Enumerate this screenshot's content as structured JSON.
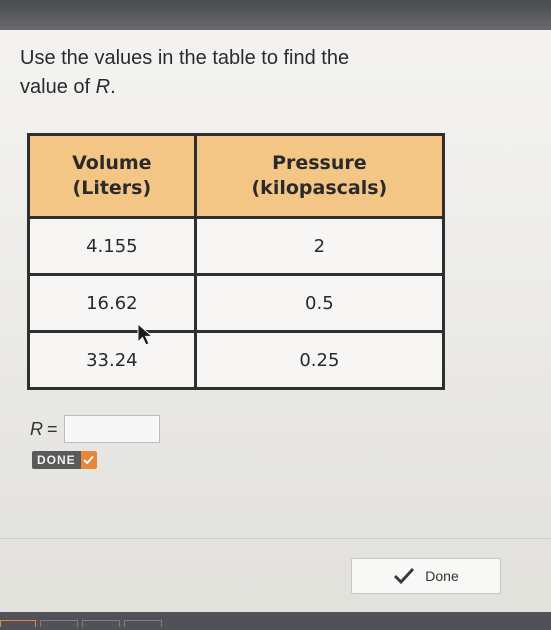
{
  "question": {
    "line1": "Use the values in the table to find the",
    "line2_prefix": "value of ",
    "variable": "R",
    "line2_suffix": "."
  },
  "table": {
    "headers": [
      {
        "line1": "Volume",
        "line2": "(Liters)"
      },
      {
        "line1": "Pressure",
        "line2": "(kilopascals)"
      }
    ],
    "rows": [
      [
        "4.155",
        "2"
      ],
      [
        "16.62",
        "0.5"
      ],
      [
        "33.24",
        "0.25"
      ]
    ]
  },
  "answer": {
    "label": "R",
    "equals": "=",
    "value": ""
  },
  "done_small": {
    "label": "DONE"
  },
  "done_button": {
    "label": "Done"
  },
  "colors": {
    "header_bg": "#f3c686",
    "done_accent": "#e8863a"
  }
}
